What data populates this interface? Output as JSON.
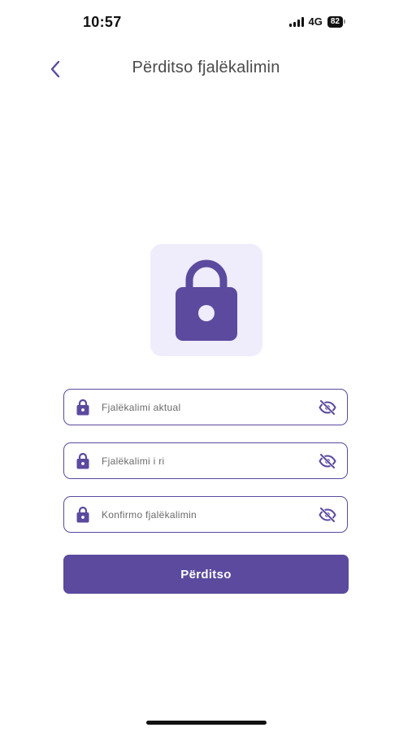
{
  "status_bar": {
    "time": "10:57",
    "network": "4G",
    "battery": "82"
  },
  "header": {
    "title": "Përditso fjalëkalimin",
    "back_icon": "chevron-left-icon"
  },
  "illustration": {
    "icon": "lock-icon"
  },
  "fields": [
    {
      "placeholder": "Fjalëkalimi aktual",
      "value": "",
      "leading_icon": "lock-icon",
      "trailing_icon": "eye-off-icon"
    },
    {
      "placeholder": "Fjalëkalimi i ri",
      "value": "",
      "leading_icon": "lock-icon",
      "trailing_icon": "eye-off-icon"
    },
    {
      "placeholder": "Konfirmo fjalëkalimin",
      "value": "",
      "leading_icon": "lock-icon",
      "trailing_icon": "eye-off-icon"
    }
  ],
  "submit": {
    "label": "Përditso"
  },
  "colors": {
    "accent": "#5b4a9e",
    "tile_background": "#efecfb",
    "title_text": "#4a4a4a"
  }
}
